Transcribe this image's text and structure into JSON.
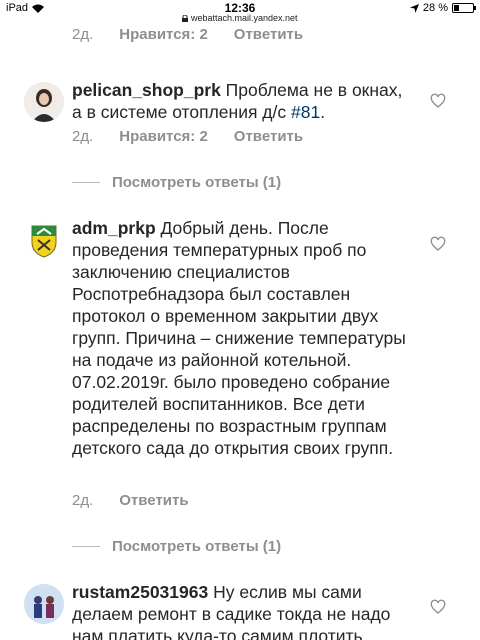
{
  "status_bar": {
    "device": "iPad",
    "time": "12:36",
    "url": "webattach.mail.yandex.net",
    "battery_text": "28 %",
    "battery_level": 0.28
  },
  "top_partial": {
    "age": "2д.",
    "likes": "Нравится: 2",
    "reply": "Ответить"
  },
  "comments": [
    {
      "username": "pelican_shop_prk",
      "text": " Проблема не в окнах, а в системе отопления д/с ",
      "tag": "#81",
      "text_after": ".",
      "age": "2д.",
      "likes": "Нравится: 2",
      "reply": "Ответить",
      "view_replies": "Посмотреть ответы (1)"
    },
    {
      "username": "adm_prkp",
      "text": " Добрый день. После проведения температурных проб по заключению специалистов Роспотребнадзора был составлен протокол о временном закрытии двух групп. Причина – снижение температуры на подаче из районной котельной.",
      "text2": "07.02.2019г. было проведено собрание родителей воспитанников. Все дети распределены по возрастным группам детского сада до открытия своих групп.",
      "age": "2д.",
      "reply": "Ответить",
      "view_replies": "Посмотреть ответы (1)"
    },
    {
      "username": "rustam25031963",
      "text": " Ну еслив мы сами делаем ремонт в садике токда не надо нам платить куда-то самим плотить"
    }
  ],
  "colors": {
    "text": "#262626",
    "muted": "#8e8e8e",
    "hashtag": "#003569"
  },
  "icons": {
    "like": "heart-outline-icon",
    "location": "location-arrow-icon",
    "lock": "lock-icon"
  }
}
